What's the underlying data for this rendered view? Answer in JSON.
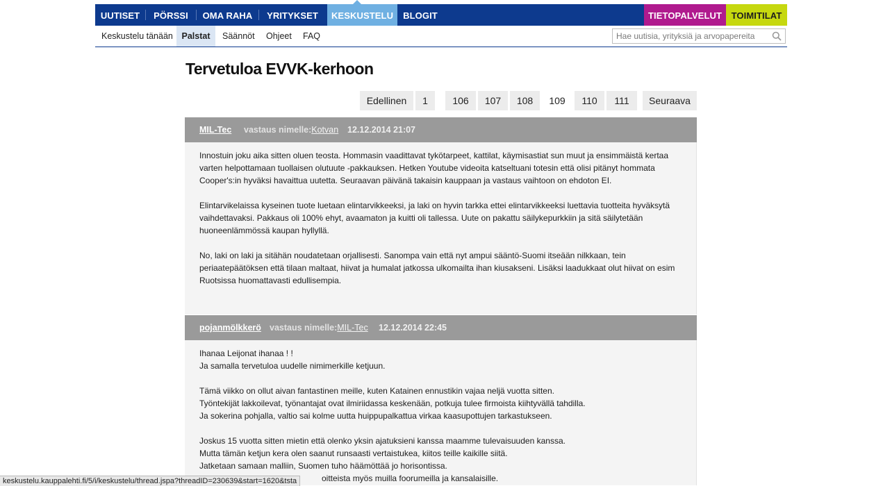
{
  "topnav": {
    "items": [
      "UUTISET",
      "PÖRSSI",
      "OMA RAHA",
      "YRITYKSET",
      "KESKUSTELU",
      "BLOGIT"
    ],
    "right": [
      "TIETOPALVELUT",
      "TOIMITILAT"
    ],
    "active": "KESKUSTELU",
    "colors": {
      "bar": "#0d3a8e",
      "active": "#6fb0e2",
      "tieto": "#b01a8e",
      "toimi": "#c6d80f"
    }
  },
  "subnav": {
    "items": [
      "Keskustelu tänään",
      "Palstat",
      "Säännöt",
      "Ohjeet",
      "FAQ"
    ],
    "active": "Palstat"
  },
  "search": {
    "placeholder": "Hae uutisia, yrityksiä ja arvopapereita"
  },
  "page_title": "Tervetuloa EVVK-kerhoon",
  "pagination": {
    "prev": "Edellinen",
    "pages": [
      "1",
      "106",
      "107",
      "108",
      "109",
      "110",
      "111"
    ],
    "current": "109",
    "next": "Seuraava"
  },
  "posts": [
    {
      "author": "MIL-Tec",
      "reply_label": "vastaus nimelle:",
      "reply_to": "Kotvan",
      "date": "12.12.2014 21:07",
      "paragraphs": [
        "Innostuin joku aika sitten oluen teosta. Hommasin vaadittavat tykötarpeet, kattilat, käymisastiat sun muut ja ensimmäistä kertaa varten helpottamaan tuollaisen olutuute -pakkauksen. Hetken Youtube videoita katseltuani totesin että olisi pitänyt hommata Cooper's:in hyväksi havaittua uutetta. Seuraavan päivänä takaisin kauppaan ja vastaus vaihtoon on ehdoton EI.",
        "Elintarvikelaissa kyseinen tuote luetaan elintarvikkeeksi, ja laki on hyvin tarkka ettei elintarvikkeeksi luettavia tuotteita hyväksytä vaihdettavaksi. Pakkaus oli 100% ehyt, avaamaton ja kuitti oli tallessa. Uute on pakattu säilykepurkkiin ja sitä säilytetään huoneenlämmössä kaupan hyllyllä.",
        "No, laki on laki ja sitähän noudatetaan orjallisesti. Sanompa vain että nyt ampui sääntö-Suomi itseään nilkkaan, tein periaatepäätöksen että tilaan maltaat, hiivat ja humalat jatkossa ulkomailta ihan kiusakseni. Lisäksi laadukkaat olut hiivat on esim Ruotsissa huomattavasti edullisempia."
      ]
    },
    {
      "author": "pojanmölkkerö",
      "reply_label": "vastaus nimelle:",
      "reply_to": "MIL-Tec",
      "date": "12.12.2014 22:45",
      "lines": [
        "Ihanaa Leijonat ihanaa ! !",
        "Ja samalla tervetuloa uudelle nimimerkille ketjuun.",
        "",
        "Tämä viikko on ollut aivan fantastinen meille, kuten Katainen ennustikin vajaa neljä vuotta sitten.",
        "Työntekijät lakkoilevat, työnantajat ovat ilmiriidassa keskenään, potkuja tulee firmoista kiihtyvällä tahdilla.",
        "Ja sokerina pohjalla, valtio sai kolme uutta huippupalkattua virkaa kaasupottujen tarkastukseen.",
        "",
        "Joskus 15 vuotta sitten mietin että olenko yksin ajatuksieni kanssa maamme tulevaisuuden kanssa.",
        "Mutta tämän ketjun kera olen saanut runsaasti vertaistukea, kiitos teille kaikille siitä.",
        "Jatketaan samaan malliin, Suomen tuho häämöttää jo horisontissa.",
        "oitteista myös muilla foorumeilla ja kansalaisille."
      ]
    }
  ],
  "statusbar": {
    "url": "keskustelu.kauppalehti.fi/5/i/keskustelu/thread.jspa?threadID=230639&start=1620&tsta"
  },
  "icons": {
    "search": "search-icon"
  }
}
